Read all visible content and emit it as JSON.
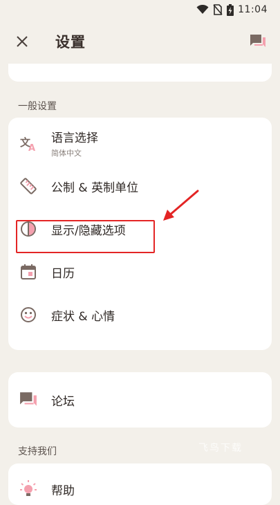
{
  "status_bar": {
    "time": "11:04",
    "icons": [
      "wifi-icon",
      "no-sim-icon",
      "battery-charging-icon"
    ]
  },
  "app_bar": {
    "title": "设置",
    "close_icon": "close-icon",
    "action_icon": "forum-icon"
  },
  "general": {
    "heading": "一般设置",
    "items": [
      {
        "label": "语言选择",
        "sublabel": "简体中文",
        "icon": "translate-icon"
      },
      {
        "label": "公制 & 英制单位",
        "icon": "ruler-icon"
      },
      {
        "label": "显示/隐藏选项",
        "icon": "contrast-icon"
      },
      {
        "label": "日历",
        "icon": "calendar-icon"
      },
      {
        "label": "症状 & 心情",
        "icon": "smiley-icon"
      }
    ]
  },
  "community": {
    "items": [
      {
        "label": "论坛",
        "icon": "forum-icon"
      }
    ]
  },
  "support": {
    "heading": "支持我们",
    "items": [
      {
        "label": "帮助",
        "icon": "lightbulb-icon"
      }
    ]
  },
  "watermark": "飞鸟下载",
  "colors": {
    "background": "#f3f0ea",
    "card": "#ffffff",
    "icon_brown": "#7a6a63",
    "icon_pink": "#f4a0ae",
    "annotation_red": "#e32424"
  }
}
